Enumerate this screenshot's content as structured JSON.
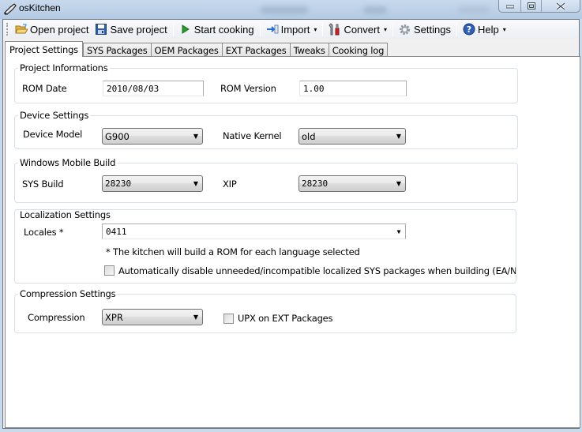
{
  "window": {
    "title": "osKitchen",
    "minimize_label": "—",
    "maximize_label": "□",
    "close_label": "✕"
  },
  "toolbar": {
    "open_project": {
      "label": "Open project",
      "icon": "folder-open-icon"
    },
    "save_project": {
      "label": "Save project",
      "icon": "save-icon"
    },
    "start_cooking": {
      "label": "Start cooking",
      "icon": "play-icon"
    },
    "import": {
      "label": "Import",
      "icon": "import-arrow-icon",
      "dropdown": "▾"
    },
    "convert": {
      "label": "Convert",
      "icon": "tools-icon",
      "dropdown": "▾"
    },
    "settings": {
      "label": "Settings",
      "icon": "gear-icon"
    },
    "help": {
      "label": "Help",
      "icon": "help-icon",
      "dropdown": "▾"
    }
  },
  "tabs": [
    {
      "label": "Project Settings",
      "active": true
    },
    {
      "label": "SYS Packages",
      "active": false
    },
    {
      "label": "OEM Packages",
      "active": false
    },
    {
      "label": "EXT Packages",
      "active": false
    },
    {
      "label": "Tweaks",
      "active": false
    },
    {
      "label": "Cooking log",
      "active": false
    }
  ],
  "project_informations": {
    "title": "Project Informations",
    "rom_date_label": "ROM Date",
    "rom_date_value": "2010/08/03",
    "rom_version_label": "ROM Version",
    "rom_version_value": "1.00"
  },
  "device_settings": {
    "title": "Device Settings",
    "device_model_label": "Device Model",
    "device_model_value": "G900",
    "native_kernel_label": "Native Kernel",
    "native_kernel_value": "old"
  },
  "wm_build": {
    "title": "Windows Mobile Build",
    "sys_build_label": "SYS Build",
    "sys_build_value": "28230",
    "xip_label": "XIP",
    "xip_value": "28230"
  },
  "localization": {
    "title": "Localization Settings",
    "locales_label": "Locales *",
    "locales_value": "0411",
    "note": "* The kitchen will build a ROM for each language selected",
    "auto_disable_label": "Automatically disable unneeded/incompatible localized SYS packages when building (EA/NonEA, etc)",
    "auto_disable_checked": false
  },
  "compression": {
    "title": "Compression Settings",
    "compression_label": "Compression",
    "compression_value": "XPR",
    "upx_label": "UPX on EXT Packages",
    "upx_checked": false
  },
  "dropdown_arrow": "▼"
}
